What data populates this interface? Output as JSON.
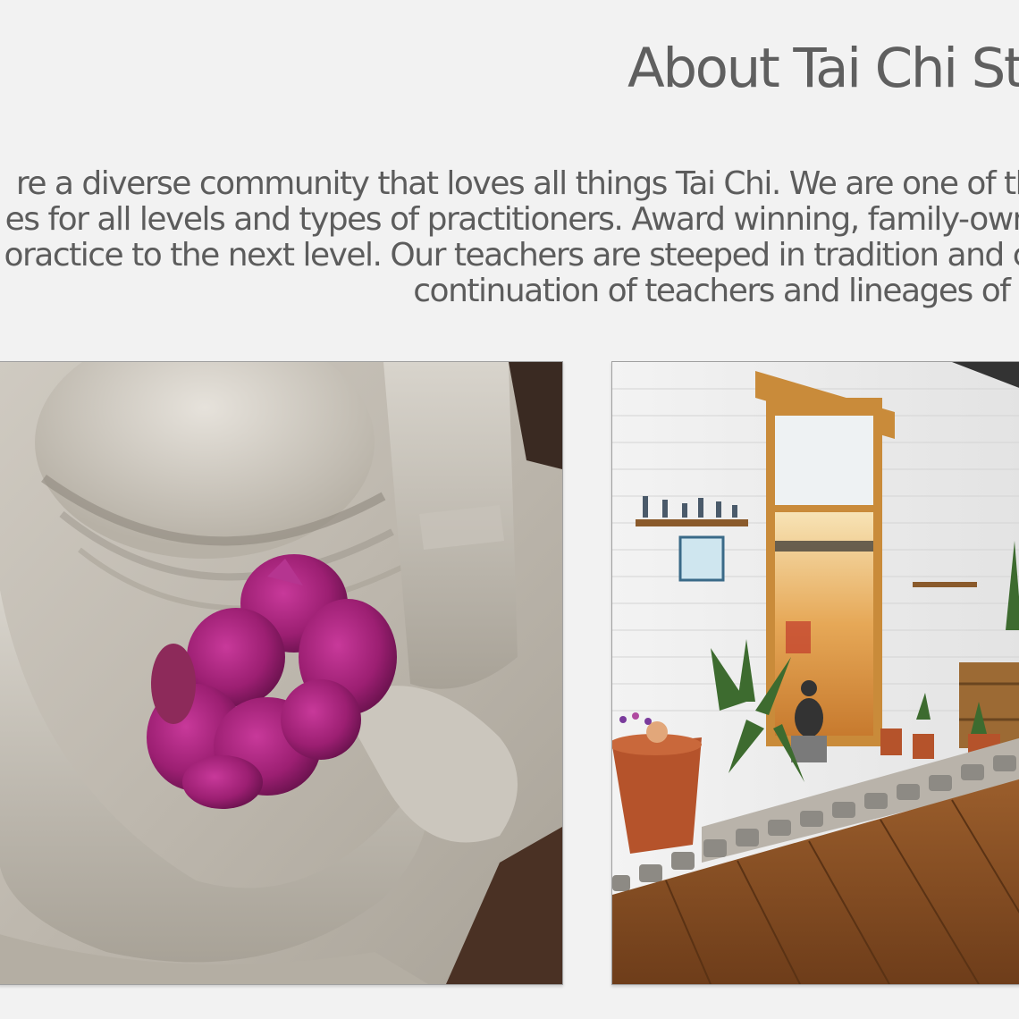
{
  "about": {
    "heading": "About Tai Chi St",
    "intro_lines": [
      "re a diverse community that loves all things Tai Chi. We are one of th",
      "es for all levels and types of practitioners. Award winning, family-own",
      "oractice to the next level. Our teachers are steeped in tradition and c",
      "continuation of teachers and lineages of t"
    ]
  },
  "gallery": {
    "photos": [
      {
        "subject": "stone statue hands holding magenta flower petals"
      },
      {
        "subject": "studio entrance with white brick wall, wooden door frame, plants and wooden deck"
      }
    ]
  },
  "colors": {
    "page_background": "#f2f2f2",
    "text": "#5c5c5c",
    "flower_magenta": "#b0287e",
    "wood_deck": "#8a5228"
  }
}
